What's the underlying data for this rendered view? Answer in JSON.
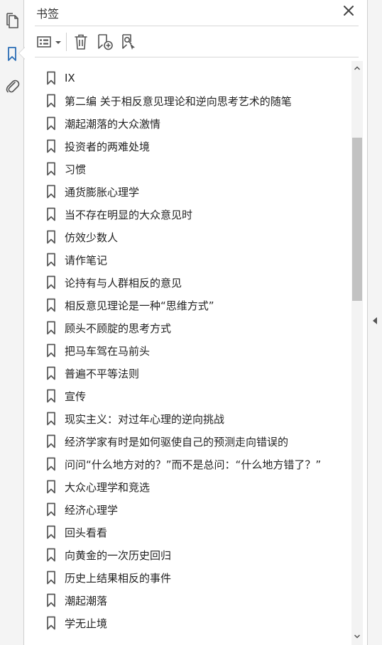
{
  "panel": {
    "title": "书签"
  },
  "rail": {
    "items": [
      {
        "name": "pages",
        "icon": "pages-icon"
      },
      {
        "name": "bookmarks",
        "icon": "bookmark-icon",
        "active": true
      },
      {
        "name": "attachments",
        "icon": "paperclip-icon"
      }
    ]
  },
  "toolbar": {
    "buttons": [
      {
        "icon": "options-list-icon"
      },
      {
        "icon": "trash-icon"
      },
      {
        "icon": "new-bookmark-icon"
      },
      {
        "icon": "bookmark-find-icon"
      }
    ]
  },
  "bookmarks": [
    "IX",
    "第二编  关于相反意见理论和逆向思考艺术的随笔",
    "潮起潮落的大众激情",
    "投资者的两难处境",
    "习惯",
    "通货膨胀心理学",
    "当不存在明显的大众意见时",
    "仿效少数人",
    "请作笔记",
    "论持有与人群相反的意见",
    "相反意见理论是一种“思维方式”",
    "顾头不顾腚的思考方式",
    "把马车驾在马前头",
    "普遍不平等法则",
    "宣传",
    "现实主义：对过年心理的逆向挑战",
    "经济学家有时是如何驱使自己的预测走向错误的",
    "问问“什么地方对的？”而不是总问：“什么地方错了？”",
    "大众心理学和竞选",
    "经济心理学",
    "回头看看",
    "向黄金的一次历史回归",
    "历史上结果相反的事件",
    "潮起潮落",
    "学无止境"
  ],
  "colors": {
    "accent": "#2a6db5",
    "icon": "#555555",
    "text": "#222222"
  }
}
